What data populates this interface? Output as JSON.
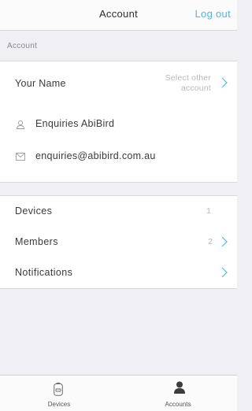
{
  "header": {
    "title": "Account",
    "logout_label": "Log out"
  },
  "section": {
    "account_header": "Account"
  },
  "profile": {
    "name_label": "Your Name",
    "select_other_label": "Select other account",
    "display_name": "Enquiries AbiBird",
    "email": "enquiries@abibird.com.au"
  },
  "menu": {
    "items": [
      {
        "label": "Devices",
        "count": "1"
      },
      {
        "label": "Members",
        "count": "2"
      },
      {
        "label": "Notifications",
        "count": ""
      }
    ]
  },
  "tabbar": {
    "tabs": [
      {
        "label": "Devices",
        "icon": "device-icon"
      },
      {
        "label": "Accounts",
        "icon": "person-icon"
      }
    ]
  },
  "colors": {
    "accent": "#49b8e8",
    "background": "#efeff4"
  }
}
